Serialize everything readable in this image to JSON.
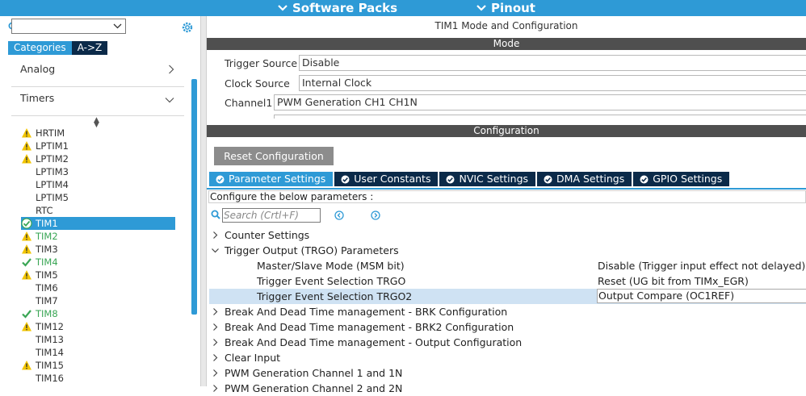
{
  "top_menu": {
    "software_packs": "Software Packs",
    "pinout": "Pinout"
  },
  "left": {
    "tabs": {
      "categories": "Categories",
      "az": "A->Z"
    },
    "categories": [
      {
        "label": "Analog",
        "expanded": false
      },
      {
        "label": "Timers",
        "expanded": true
      }
    ],
    "peripherals": [
      {
        "label": "HRTIM",
        "status": "warning"
      },
      {
        "label": "LPTIM1",
        "status": "warning"
      },
      {
        "label": "LPTIM2",
        "status": "warning"
      },
      {
        "label": "LPTIM3",
        "status": "none"
      },
      {
        "label": "LPTIM4",
        "status": "none"
      },
      {
        "label": "LPTIM5",
        "status": "none"
      },
      {
        "label": "RTC",
        "status": "none"
      },
      {
        "label": "TIM1",
        "status": "ok-selected"
      },
      {
        "label": "TIM2",
        "status": "warning-green"
      },
      {
        "label": "TIM3",
        "status": "warning"
      },
      {
        "label": "TIM4",
        "status": "ok"
      },
      {
        "label": "TIM5",
        "status": "warning"
      },
      {
        "label": "TIM6",
        "status": "none"
      },
      {
        "label": "TIM7",
        "status": "none"
      },
      {
        "label": "TIM8",
        "status": "ok"
      },
      {
        "label": "TIM12",
        "status": "warning"
      },
      {
        "label": "TIM13",
        "status": "none"
      },
      {
        "label": "TIM14",
        "status": "none"
      },
      {
        "label": "TIM15",
        "status": "warning"
      },
      {
        "label": "TIM16",
        "status": "none"
      }
    ]
  },
  "right": {
    "title": "TIM1 Mode and Configuration",
    "mode_bar": "Mode",
    "mode_rows": [
      {
        "label": "Trigger Source",
        "value": "Disable"
      },
      {
        "label": "Clock Source",
        "value": "Internal Clock"
      },
      {
        "label": "Channel1",
        "value": "PWM Generation CH1 CH1N"
      }
    ],
    "config_bar": "Configuration",
    "reset_button": "Reset Configuration",
    "config_tabs": [
      "Parameter Settings",
      "User Constants",
      "NVIC Settings",
      "DMA Settings",
      "GPIO Settings"
    ],
    "configure_label": "Configure the below parameters :",
    "search_placeholder": "Search (Crtl+F)",
    "tree": [
      {
        "label": "Counter Settings",
        "type": "collapsed"
      },
      {
        "label": "Trigger Output (TRGO) Parameters",
        "type": "expanded"
      },
      {
        "label": "Master/Slave Mode (MSM bit)",
        "type": "child",
        "value": "Disable (Trigger input effect not delayed)"
      },
      {
        "label": "Trigger Event Selection TRGO",
        "type": "child",
        "value": "Reset (UG bit from TIMx_EGR)"
      },
      {
        "label": "Trigger Event Selection TRGO2",
        "type": "child-selected",
        "value": "Output Compare (OC1REF)"
      },
      {
        "label": "Break And Dead Time management - BRK Configuration",
        "type": "collapsed"
      },
      {
        "label": "Break And Dead Time management - BRK2 Configuration",
        "type": "collapsed"
      },
      {
        "label": "Break And Dead Time management - Output Configuration",
        "type": "collapsed"
      },
      {
        "label": "Clear Input",
        "type": "collapsed"
      },
      {
        "label": "PWM Generation Channel 1 and 1N",
        "type": "collapsed"
      },
      {
        "label": "PWM Generation Channel 2 and 2N",
        "type": "collapsed"
      }
    ]
  },
  "colors": {
    "accent": "#2e9ad6",
    "dark_tab": "#0b2a49",
    "section_bar": "#4f4f4f",
    "warning": "#f2c500",
    "ok": "#3aa655",
    "row_highlight": "#cfe2f3"
  }
}
